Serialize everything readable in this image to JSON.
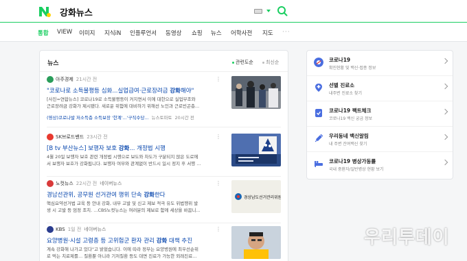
{
  "header": {
    "query": "강화뉴스"
  },
  "nav": {
    "items": [
      "통합",
      "VIEW",
      "이미지",
      "지식iN",
      "인플루언서",
      "동영상",
      "쇼핑",
      "뉴스",
      "어학사전",
      "지도"
    ],
    "more": "···",
    "active_color": "#19ce60"
  },
  "news": {
    "title": "뉴스",
    "sort": [
      "관련도순",
      "최신순"
    ],
    "items": [
      {
        "press": "아주경제",
        "time": "21시간 전",
        "title_pre": "\"코로나로 소득불평등 심화...실업급여·근로장려금 ",
        "title_em": "강화",
        "title_post": "해야\"",
        "desc_1": "[사진=연합뉴스] 코로나19로 소득불평등이 커지면서 이에 대한으로 실업부조와",
        "desc_2": "근로장려금 강화가 제시됐다. 새로운 위험에 대비하기 위해선 노인과 근로빈곤층...",
        "related_1": "(영상)코로나발 저소득층 소득보장 '한계'...'구직수당...",
        "related_2": "뉴스토마토",
        "related_3": "20시간 전"
      },
      {
        "press": "SK브로드밴드",
        "time": "23시간 전",
        "title_pre": "[B tv 부산뉴스] 보행자 보호 ",
        "title_em": "강화",
        "title_post": "... 개정법 시행",
        "desc_1": "4월 20일 보행자 보호 관련 개정법 시행으로 보도와 차도가 구분되지 않은 도로에",
        "desc_2": "서 보행자 보호가 강화됩니다. 보행자 여부와 관계없이 반드시 일시 정지 후 서행 ..."
      },
      {
        "press": "노컷뉴스",
        "time": "22시간 전",
        "sub": "네이버뉴스",
        "title_pre": "경남선관위, 공무원 선거관여 행위 단속 ",
        "title_em": "강화",
        "title_post": "한다",
        "desc_1": "핵심요약선거법 교육 등 안내 강화, 내부 고발 및 신고 제보 적극 유도 위법행위 발",
        "desc_2": "생 시 고발 등 엄정 조치. ...CBS노컷뉴스는 여러분의 제보로 함께 세상을 바꿉니...",
        "thumb_text": "경상남도선거관리위원회"
      },
      {
        "press": "KBS",
        "time": "1일 전",
        "sub": "네이버뉴스",
        "title_pre": "요양병원·시설 고령층 등 고위험군 환자 관리 ",
        "title_em": "강화",
        "title_post": " 대책 추진",
        "desc_1": "계속 강화해 나가고 있다\"고 밝혔습니다. 이에 따라 정부는 요양병원에 최우선순위",
        "desc_2": "로 먹는 치료제를... 질환뿐 아니라 기저질환 등도 대면 진료가 가능한 외래진료..."
      }
    ]
  },
  "side": {
    "rows": [
      {
        "title": "코로나19",
        "sub": "확진현황 및 백신·접종 정보"
      },
      {
        "title": "선별 진료소",
        "sub": "내주변 진료소 찾기"
      },
      {
        "title": "코로나19 팩트체크",
        "sub": "코로나19 백신 궁금 정보"
      },
      {
        "title": "우리동네 백신알림",
        "sub": "내 주변 잔여백신 찾기"
      },
      {
        "title": "코로나19 병상가동률",
        "sub": "국내 중환자/일반병상 현황 보기"
      }
    ]
  },
  "watermark": {
    "text": "우리투데이"
  }
}
